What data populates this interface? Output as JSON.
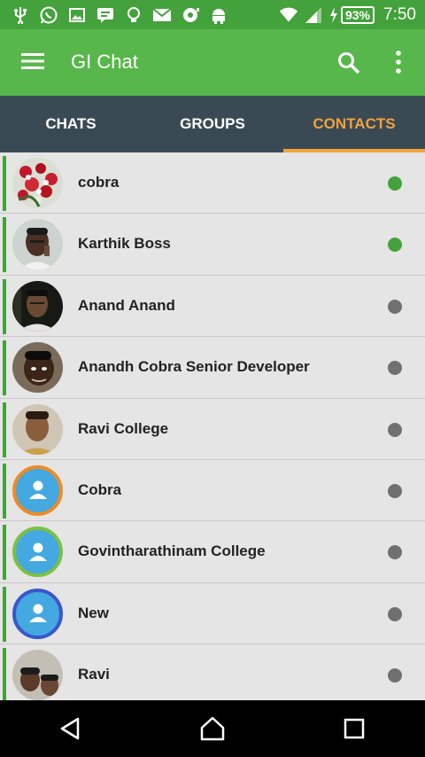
{
  "status_bar": {
    "icons": [
      "usb-icon",
      "whatsapp-icon",
      "image-icon",
      "messenger-icon",
      "bulb-icon",
      "mail-icon",
      "toggle-icon",
      "android-icon"
    ],
    "battery": "93%",
    "time": "7:50"
  },
  "app_bar": {
    "title": "GI Chat",
    "color": "#58b74a"
  },
  "tabs": [
    {
      "label": "CHATS",
      "active": false
    },
    {
      "label": "GROUPS",
      "active": false
    },
    {
      "label": "CONTACTS",
      "active": true
    }
  ],
  "contacts": [
    {
      "name": "cobra",
      "online": true,
      "avatar": "photo-flowers"
    },
    {
      "name": "Karthik Boss",
      "online": true,
      "avatar": "photo-man"
    },
    {
      "name": "Anand Anand",
      "online": false,
      "avatar": "photo-man"
    },
    {
      "name": "Anandh Cobra Senior Developer",
      "online": false,
      "avatar": "photo-man"
    },
    {
      "name": "Ravi College",
      "online": false,
      "avatar": "photo-boy"
    },
    {
      "name": "Cobra",
      "online": false,
      "avatar": "placeholder",
      "ring_color": "#f08a24"
    },
    {
      "name": "Govintharathinam College",
      "online": false,
      "avatar": "placeholder",
      "ring_color": "#7cc043"
    },
    {
      "name": "New",
      "online": false,
      "avatar": "placeholder",
      "ring_color": "#3a56c9"
    },
    {
      "name": "Ravi",
      "online": false,
      "avatar": "photo-group"
    }
  ],
  "colors": {
    "online": "#43a23b",
    "offline": "#707070",
    "accent_tab": "#f2a23a"
  },
  "nav_bar": {
    "icons": [
      "back-icon",
      "home-icon",
      "recents-icon"
    ]
  }
}
